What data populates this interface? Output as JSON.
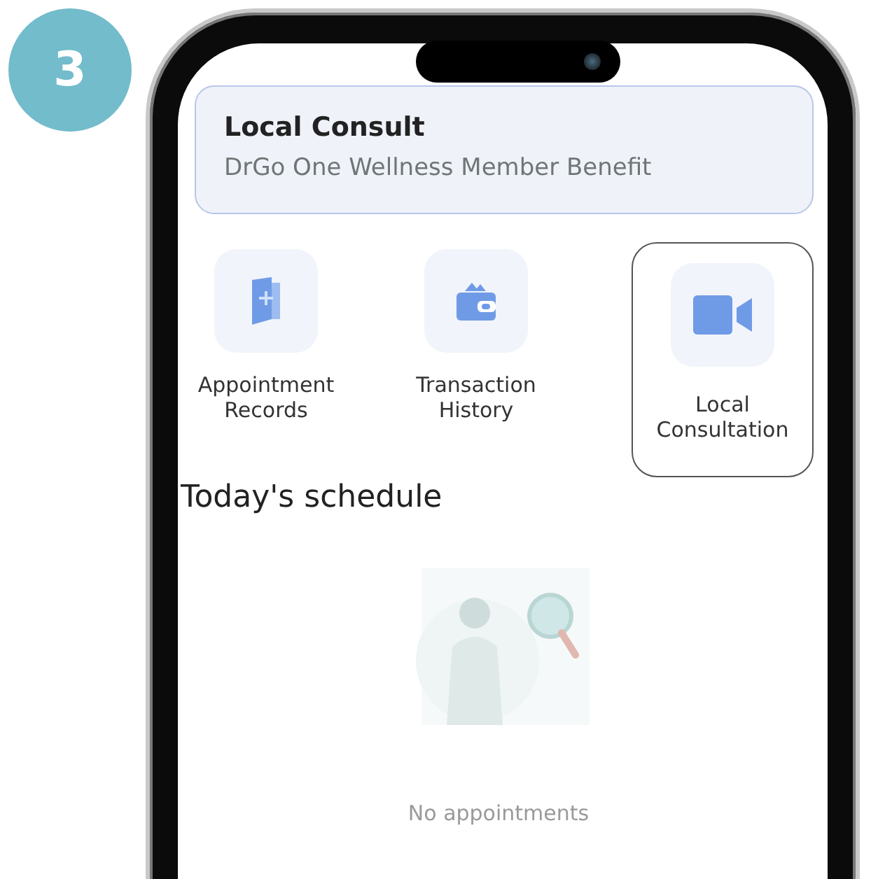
{
  "step_badge": "3",
  "card": {
    "title": "Local Consult",
    "subtitle": "DrGo One Wellness Member Benefit"
  },
  "menu": [
    {
      "kind": "records",
      "label": "Appointment Records",
      "selected": false
    },
    {
      "kind": "wallet",
      "label": "Transaction History",
      "selected": false
    },
    {
      "kind": "video",
      "label": "Local Consultation",
      "selected": true
    }
  ],
  "schedule": {
    "heading": "Today's schedule",
    "empty_text": "No appointments"
  }
}
